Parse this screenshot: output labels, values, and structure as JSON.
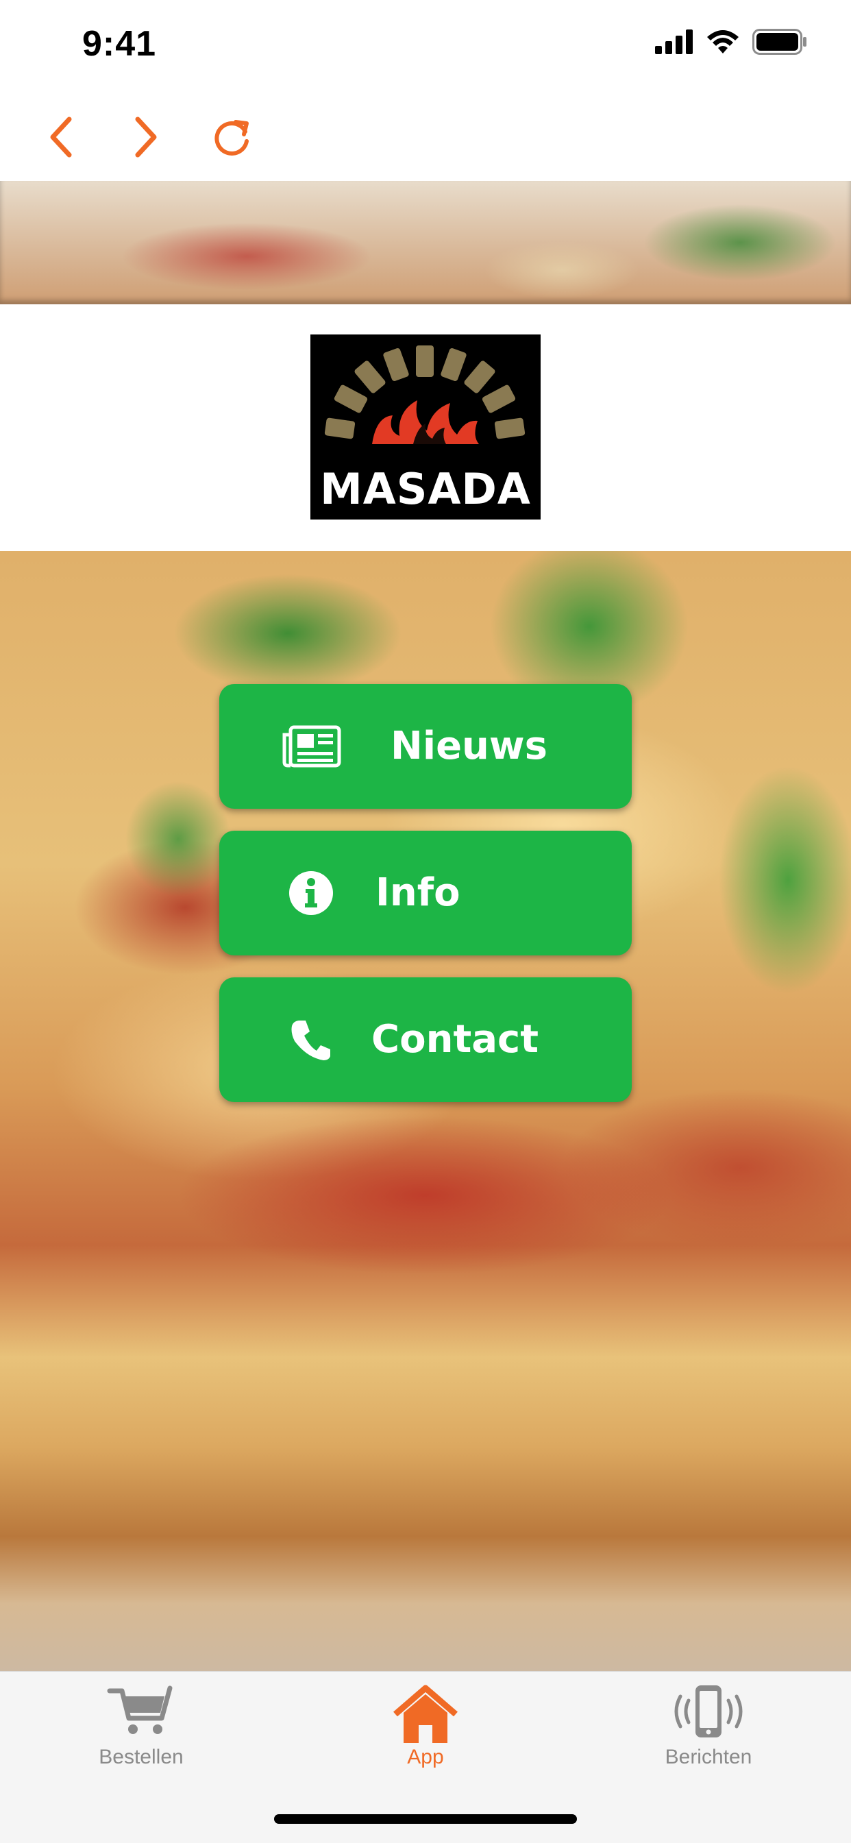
{
  "status_bar": {
    "time": "9:41",
    "icons": [
      "cellular-signal-icon",
      "wifi-icon",
      "battery-icon"
    ]
  },
  "browser_nav": {
    "buttons": [
      "back-arrow-icon",
      "forward-arrow-icon",
      "reload-icon"
    ],
    "accent_color": "#f06a25"
  },
  "logo": {
    "text": "MASADA"
  },
  "menu": {
    "button_color": "#1db546",
    "items": [
      {
        "label": "Nieuws",
        "icon": "newspaper-icon"
      },
      {
        "label": "Info",
        "icon": "info-circle-icon"
      },
      {
        "label": "Contact",
        "icon": "phone-icon"
      }
    ]
  },
  "tab_bar": {
    "active_color": "#f06a25",
    "inactive_color": "#8a8a8a",
    "tabs": [
      {
        "label": "Bestellen",
        "icon": "shopping-cart-icon",
        "active": false
      },
      {
        "label": "App",
        "icon": "home-icon",
        "active": true
      },
      {
        "label": "Berichten",
        "icon": "phone-notification-icon",
        "active": false
      }
    ]
  }
}
